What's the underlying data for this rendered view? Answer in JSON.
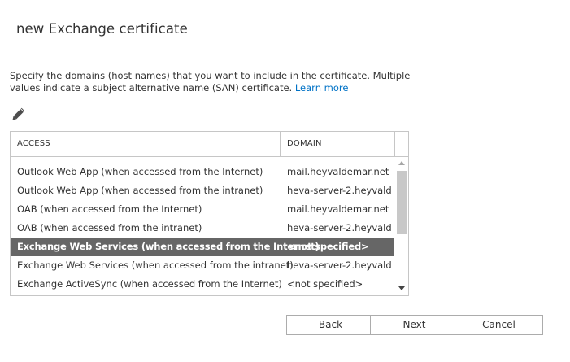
{
  "header": {
    "title": "new Exchange certificate"
  },
  "intro": {
    "text": "Specify the domains (host names) that you want to include in the certificate. Multiple values indicate a subject alternative name (SAN) certificate. ",
    "link": "Learn more"
  },
  "toolbar": {
    "edit_icon": "pencil-icon"
  },
  "grid": {
    "columns": [
      "ACCESS",
      "DOMAIN"
    ],
    "rows": [
      {
        "access": "Outlook Web App (when accessed from the Internet)",
        "domain": "mail.heyvaldemar.net"
      },
      {
        "access": "Outlook Web App (when accessed from the intranet)",
        "domain": "heva-server-2.heyvald..."
      },
      {
        "access": "OAB (when accessed from the Internet)",
        "domain": "mail.heyvaldemar.net"
      },
      {
        "access": "OAB (when accessed from the intranet)",
        "domain": "heva-server-2.heyvald..."
      },
      {
        "access": "Exchange Web Services (when accessed from the Internet)",
        "domain": "<not specified>",
        "selected": true
      },
      {
        "access": "Exchange Web Services (when accessed from the intranet)",
        "domain": "heva-server-2.heyvald..."
      },
      {
        "access": "Exchange ActiveSync (when accessed from the Internet)",
        "domain": "<not specified>"
      }
    ]
  },
  "buttons": {
    "back": "Back",
    "next": "Next",
    "cancel": "Cancel"
  },
  "colors": {
    "selected_row": "#666666",
    "link": "#0072c6",
    "border": "#c6c6c6"
  }
}
